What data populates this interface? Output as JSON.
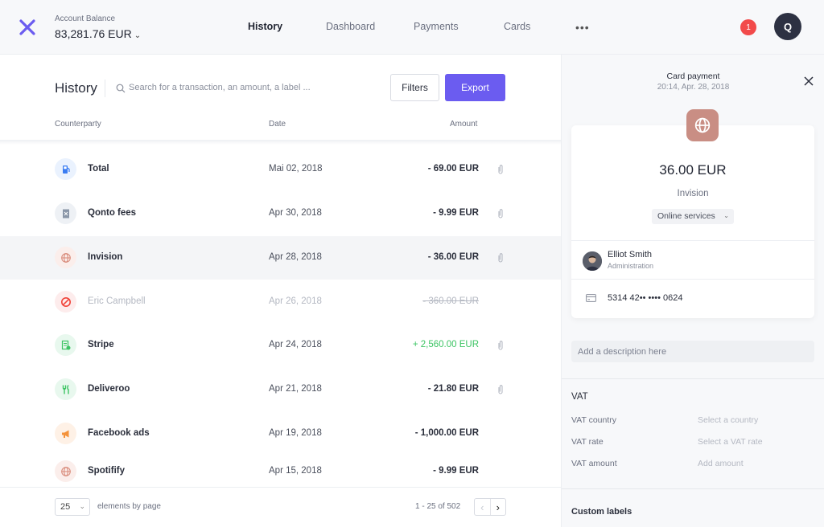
{
  "header": {
    "balance_label": "Account Balance",
    "balance_value": "83,281.76 EUR",
    "nav": [
      "History",
      "Dashboard",
      "Payments",
      "Cards"
    ],
    "more": "•••",
    "notifications": "1",
    "avatar_initial": "Q"
  },
  "history": {
    "title": "History",
    "search_placeholder": "Search for a transaction, an amount, a label ...",
    "filters_label": "Filters",
    "export_label": "Export",
    "columns": {
      "counterparty": "Counterparty",
      "date": "Date",
      "amount": "Amount"
    },
    "rows": [
      {
        "name": "Total",
        "date": "Mai 02, 2018",
        "amount": "- 69.00 EUR",
        "icon": "fuel-pump-icon",
        "icon_color": "#3a7cf2",
        "icon_bg": "#eaf2fe",
        "attachment": true,
        "state": "normal"
      },
      {
        "name": "Qonto fees",
        "date": "Apr 30, 2018",
        "amount": "- 9.99 EUR",
        "icon": "receipt-icon",
        "icon_color": "#8a96a8",
        "icon_bg": "#eef1f5",
        "attachment": true,
        "state": "normal"
      },
      {
        "name": "Invision",
        "date": "Apr 28, 2018",
        "amount": "- 36.00 EUR",
        "icon": "globe-icon",
        "icon_color": "#d98c7c",
        "icon_bg": "#fbeeeb",
        "attachment": true,
        "state": "selected"
      },
      {
        "name": "Eric Campbell",
        "date": "Apr 26, 2018",
        "amount": "- 360.00 EUR",
        "icon": "declined-icon",
        "icon_color": "#f0443a",
        "icon_bg": "#fdecec",
        "attachment": false,
        "state": "muted"
      },
      {
        "name": "Stripe",
        "date": "Apr 24, 2018",
        "amount": "+ 2,560.00 EUR",
        "icon": "invoice-icon",
        "icon_color": "#3cc463",
        "icon_bg": "#e8f8ee",
        "attachment": true,
        "state": "positive"
      },
      {
        "name": "Deliveroo",
        "date": "Apr 21, 2018",
        "amount": "- 21.80 EUR",
        "icon": "fork-knife-icon",
        "icon_color": "#3cc463",
        "icon_bg": "#e8f8ee",
        "attachment": true,
        "state": "normal"
      },
      {
        "name": "Facebook ads",
        "date": "Apr 19, 2018",
        "amount": "- 1,000.00 EUR",
        "icon": "megaphone-icon",
        "icon_color": "#f4923a",
        "icon_bg": "#fef1e6",
        "attachment": false,
        "state": "normal"
      },
      {
        "name": "Spotifify",
        "date": "Apr 15, 2018",
        "amount": "- 9.99 EUR",
        "icon": "globe-icon",
        "icon_color": "#d98c7c",
        "icon_bg": "#fbeeeb",
        "attachment": false,
        "state": "normal"
      }
    ],
    "footer": {
      "per_page": "25",
      "per_page_label": "elements by page",
      "page_info": "1 - 25 of 502"
    }
  },
  "detail": {
    "title": "Card payment",
    "subtitle": "20:14, Apr. 28, 2018",
    "amount": "36.00 EUR",
    "merchant": "Invision",
    "category": "Online services",
    "person_name": "Elliot Smith",
    "person_role": "Administration",
    "card_number": "5314 42•• •••• 0624",
    "description_placeholder": "Add a description here",
    "vat_title": "VAT",
    "vat": [
      {
        "label": "VAT country",
        "value": "Select a country"
      },
      {
        "label": "VAT rate",
        "value": "Select a VAT rate"
      },
      {
        "label": "VAT amount",
        "value": "Add amount"
      }
    ],
    "custom_labels": "Custom labels"
  },
  "colors": {
    "accent": "#6b5cf0",
    "positive": "#3cc463",
    "negative_badge": "#f24a4a"
  }
}
